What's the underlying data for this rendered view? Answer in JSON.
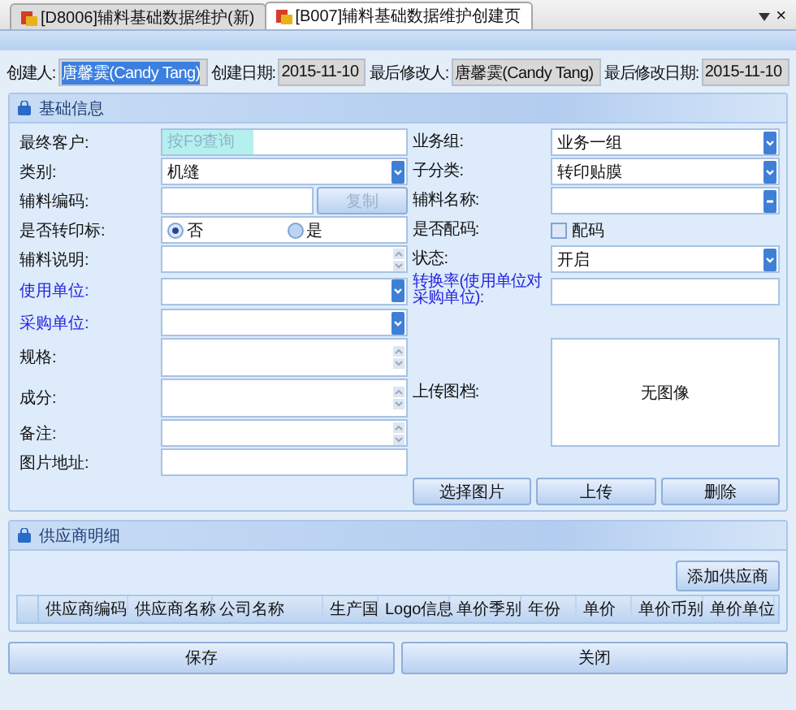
{
  "tabs": [
    {
      "label": "[D8006]辅料基础数据维护(新)",
      "selected": false
    },
    {
      "label": "[B007]辅料基础数据维护创建页",
      "selected": true
    }
  ],
  "tab_close": "×",
  "header": [
    {
      "label": "创建人:",
      "value": "唐馨霙(Candy Tang)",
      "selected": true
    },
    {
      "label": "创建日期:",
      "value": "2015-11-10",
      "selected": false
    },
    {
      "label": "最后修改人:",
      "value": "唐馨霙(Candy Tang)",
      "selected": false
    },
    {
      "label": "最后修改日期:",
      "value": "2015-11-10",
      "selected": false
    }
  ],
  "basic": {
    "title": "基础信息",
    "rows": [
      {
        "left": {
          "label": "最终客户:",
          "kind": "lookup",
          "placeholder": "按F9查询"
        },
        "right": {
          "label": "业务组:",
          "kind": "combo",
          "value": "业务一组"
        }
      },
      {
        "left": {
          "label": "类别:",
          "kind": "combo",
          "value": "机缝"
        },
        "right": {
          "label": "子分类:",
          "kind": "combo",
          "value": "转印贴膜"
        }
      },
      {
        "left": {
          "label": "辅料编码:",
          "kind": "text_button",
          "button": {
            "label": "复制",
            "disabled": true
          }
        },
        "right": {
          "label": "辅料名称:",
          "kind": "browse"
        }
      },
      {
        "left": {
          "label": "是否转印标:",
          "kind": "radio",
          "options": [
            {
              "label": "否",
              "selected": true
            },
            {
              "label": "是",
              "selected": false
            }
          ]
        },
        "right": {
          "label": "是否配码:",
          "kind": "checkbox",
          "option": {
            "label": "配码",
            "checked": false
          }
        }
      },
      {
        "left": {
          "label": "辅料说明:",
          "kind": "memo"
        },
        "right": {
          "label": "状态:",
          "kind": "combo",
          "value": "开启"
        }
      },
      {
        "left": {
          "label": "使用单位:",
          "kind": "combo",
          "emphasized": true
        },
        "right": {
          "label": "转换率(使用单位对采购单位):",
          "kind": "text",
          "emphasized": true
        }
      },
      {
        "left": {
          "label": "采购单位:",
          "kind": "combo",
          "emphasized": true
        }
      },
      {
        "left": {
          "label": "规格:",
          "kind": "textarea"
        },
        "right": {
          "label": "上传图档:",
          "kind": "image",
          "text": "无图像"
        }
      },
      {
        "left": {
          "label": "成分:",
          "kind": "textarea"
        }
      },
      {
        "left": {
          "label": "备注:",
          "kind": "memo"
        }
      },
      {
        "left": {
          "label": "图片地址:",
          "kind": "text"
        },
        "right": {
          "kind": "buttons",
          "buttons": [
            "选择图片",
            "上传",
            "删除"
          ]
        }
      }
    ]
  },
  "suppliers": {
    "title": "供应商明细",
    "add_button": "添加供应商",
    "columns": [
      "供应商编码",
      "供应商名称",
      "公司名称",
      "生产国",
      "Logo信息",
      "单价季别",
      "年份",
      "单价",
      "单价币别",
      "单价单位"
    ]
  },
  "buttons": [
    "保存",
    "关闭"
  ]
}
